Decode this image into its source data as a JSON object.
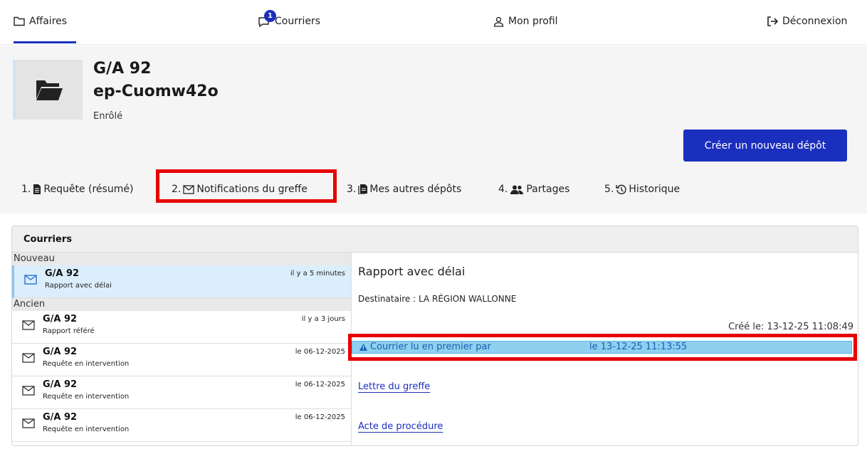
{
  "nav": {
    "affaires": "Affaires",
    "courriers": "Courriers",
    "courriers_badge": "1",
    "profil": "Mon profil",
    "logout": "Déconnexion"
  },
  "case": {
    "title": "G/A 92",
    "id": "ep-Cuomw42o",
    "status": "Enrôlé",
    "new_button": "Créer un nouveau dépôt"
  },
  "tabs": [
    {
      "num": "1.",
      "label": "Requête (résumé)",
      "icon": "document-icon"
    },
    {
      "num": "2.",
      "label": "Notifications du greffe",
      "icon": "envelope-icon"
    },
    {
      "num": "3.",
      "label": "Mes autres dépôts",
      "icon": "documents-icon"
    },
    {
      "num": "4.",
      "label": "Partages",
      "icon": "users-icon"
    },
    {
      "num": "5.",
      "label": "Historique",
      "icon": "history-icon"
    }
  ],
  "panel": {
    "title": "Courriers",
    "groups": {
      "new": "Nouveau",
      "old": "Ancien"
    },
    "mails": [
      {
        "title": "G/A 92",
        "subject": "Rapport avec délai",
        "time": "il y a 5 minutes"
      },
      {
        "title": "G/A 92",
        "subject": "Rapport référé",
        "time": "il y a 3 jours"
      },
      {
        "title": "G/A 92",
        "subject": "Requête en intervention",
        "time": "le 06-12-2025"
      },
      {
        "title": "G/A 92",
        "subject": "Requête en intervention",
        "time": "le 06-12-2025"
      },
      {
        "title": "G/A 92",
        "subject": "Requête en intervention",
        "time": "le 06-12-2025"
      }
    ]
  },
  "detail": {
    "title": "Rapport avec délai",
    "recipient": "Destinataire : LA RÉGION WALLONNE",
    "created": "Créé le: 13-12-25 11:08:49",
    "read_label": "Courrier lu en premier par",
    "read_date": "le 13-12-25 11:13:55",
    "links": [
      "Lettre du greffe",
      "Acte de procédure"
    ]
  },
  "colors": {
    "accent": "#1b2fbf",
    "highlight_red": "#e60000",
    "read_banner": "#8fd0f0"
  }
}
